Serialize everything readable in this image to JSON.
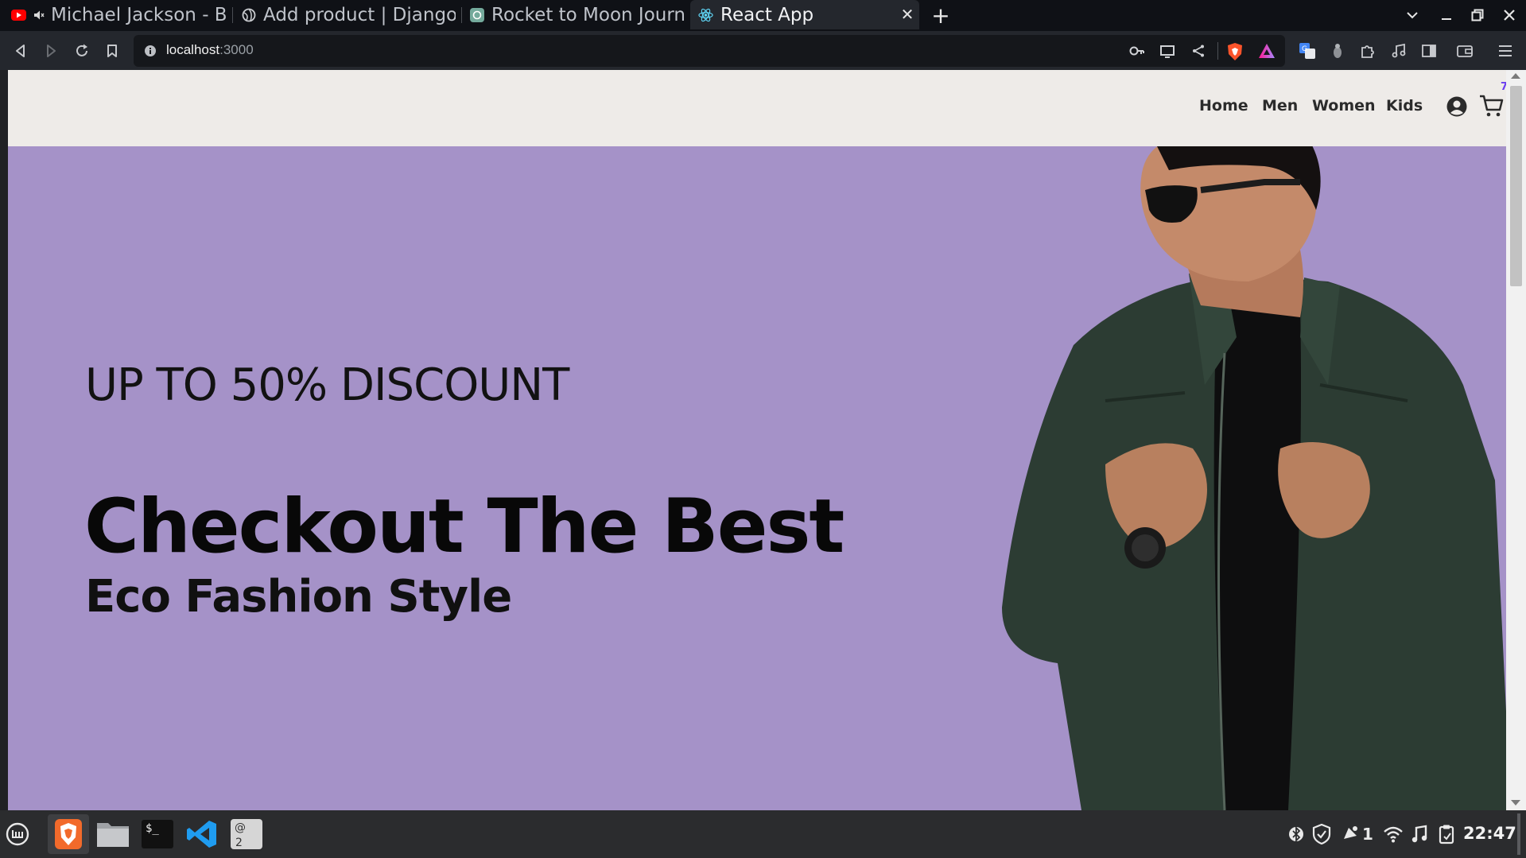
{
  "browser": {
    "tabs": [
      {
        "title": "Michael Jackson - Bea",
        "favicon": "youtube-icon",
        "muted": true,
        "active": false
      },
      {
        "title": "Add product | Django si",
        "favicon": "globe-icon",
        "active": false
      },
      {
        "title": "Rocket to Moon Journe",
        "favicon": "chatgpt-icon",
        "active": false
      },
      {
        "title": "React App",
        "favicon": "react-icon",
        "active": true
      }
    ],
    "url": {
      "host": "localhost",
      "port": ":3000"
    },
    "accent": "#f05a24"
  },
  "site": {
    "nav": {
      "links": [
        "Home",
        "Men",
        "Women",
        "Kids"
      ],
      "cart_count": "7"
    },
    "hero": {
      "discount": "UP TO 50% DISCOUNT",
      "title": "Checkout The Best",
      "subtitle": "Eco Fashion Style",
      "background": "#a592c8"
    }
  },
  "taskbar": {
    "apps": [
      "brave-browser",
      "file-manager",
      "terminal",
      "vscode",
      "workspace-2"
    ],
    "workspace_label": "2",
    "notification_count": "1",
    "clock": "22:47"
  }
}
